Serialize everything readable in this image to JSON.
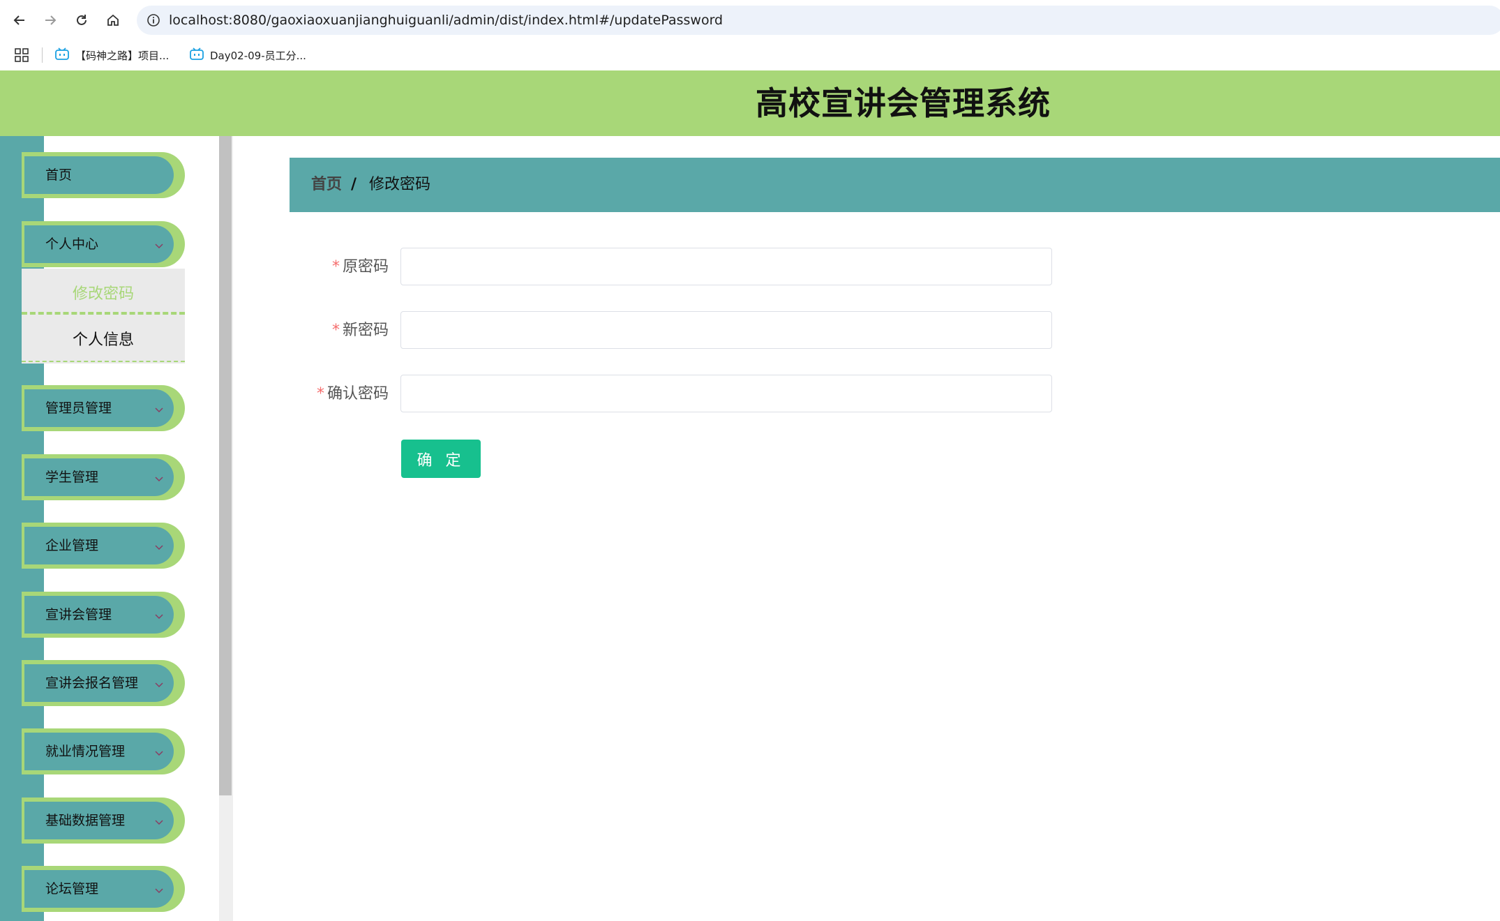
{
  "browser": {
    "url": "localhost:8080/gaoxiaoxuanjianghuiguanli/admin/dist/index.html#/updatePassword",
    "icons": [
      "back-arrow-icon",
      "forward-arrow-icon",
      "reload-icon",
      "home-icon",
      "site-info-icon"
    ],
    "bookmarks": [
      {
        "label": "【码神之路】项目...",
        "icon": "bilibili-tv-icon"
      },
      {
        "label": "Day02-09-员工分...",
        "icon": "bilibili-tv-icon"
      }
    ]
  },
  "header": {
    "title": "高校宣讲会管理系统"
  },
  "sidebar": {
    "items": [
      {
        "label": "首页",
        "has_arrow": false
      },
      {
        "label": "个人中心",
        "has_arrow": true,
        "expanded": true
      },
      {
        "label": "管理员管理",
        "has_arrow": true
      },
      {
        "label": "学生管理",
        "has_arrow": true
      },
      {
        "label": "企业管理",
        "has_arrow": true
      },
      {
        "label": "宣讲会管理",
        "has_arrow": true
      },
      {
        "label": "宣讲会报名管理",
        "has_arrow": true
      },
      {
        "label": "就业情况管理",
        "has_arrow": true
      },
      {
        "label": "基础数据管理",
        "has_arrow": true
      },
      {
        "label": "论坛管理",
        "has_arrow": true
      }
    ],
    "submenu": [
      {
        "label": "修改密码",
        "active": true
      },
      {
        "label": "个人信息",
        "active": false
      }
    ]
  },
  "breadcrumb": {
    "home": "首页",
    "separator": "/",
    "current": "修改密码"
  },
  "form": {
    "required_mark": "*",
    "fields": [
      {
        "label": "原密码",
        "value": ""
      },
      {
        "label": "新密码",
        "value": ""
      },
      {
        "label": "确认密码",
        "value": ""
      }
    ],
    "submit_label": "确 定"
  },
  "colors": {
    "header_green": "#a8d778",
    "sidebar_teal": "#5aa8a8",
    "active_submenu_text": "#a8d778",
    "button_green": "#17c08e",
    "required_red": "#f56c6c"
  }
}
